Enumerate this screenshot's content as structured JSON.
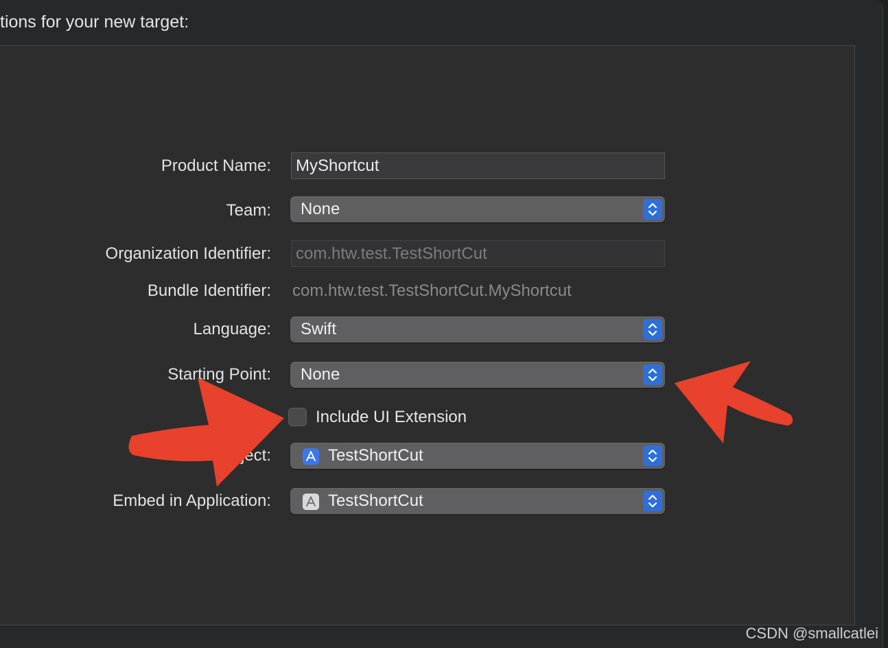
{
  "header": {
    "text": "tions for your new target:"
  },
  "form": {
    "product_name": {
      "label": "Product Name:",
      "value": "MyShortcut"
    },
    "team": {
      "label": "Team:",
      "value": "None"
    },
    "organization_identifier": {
      "label": "Organization Identifier:",
      "value": "com.htw.test.TestShortCut"
    },
    "bundle_identifier": {
      "label": "Bundle Identifier:",
      "value": "com.htw.test.TestShortCut.MyShortcut"
    },
    "language": {
      "label": "Language:",
      "value": "Swift"
    },
    "starting_point": {
      "label": "Starting Point:",
      "value": "None"
    },
    "include_ui_extension": {
      "label": "Include UI Extension",
      "checked": false
    },
    "project": {
      "label": "Project:",
      "value": "TestShortCut",
      "icon": "xcode-project-icon"
    },
    "embed_in_application": {
      "label": "Embed in Application:",
      "value": "TestShortCut",
      "icon": "app-icon"
    }
  },
  "annotations": {
    "arrow_color": "#e8412c"
  },
  "colors": {
    "accent": "#2f6fd9",
    "popup": "#5f5f61",
    "panel": "#2d2d2e"
  },
  "watermark": {
    "text": "CSDN @smallcatlei"
  }
}
